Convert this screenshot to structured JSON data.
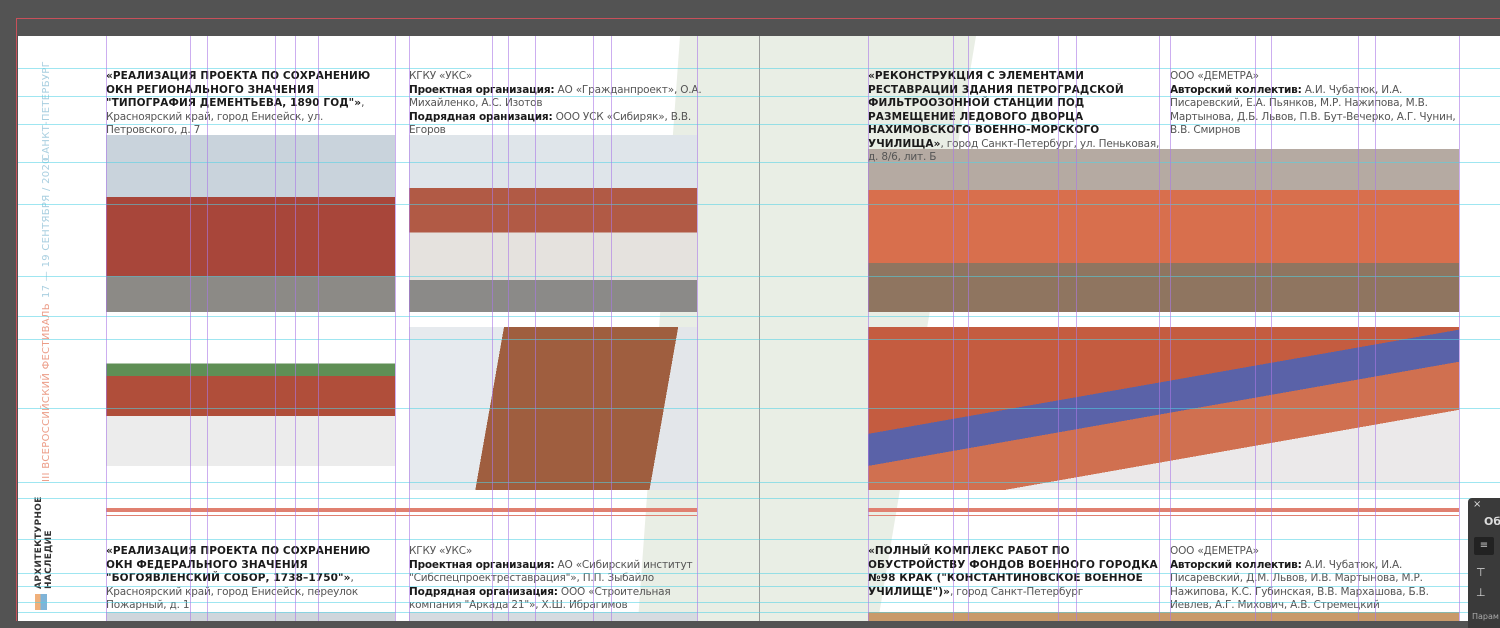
{
  "sidebar": {
    "city": "САНКТ-ПЕТЕРБУРГ",
    "dates": "17 — 19 СЕНТЯБРЯ / 2020",
    "festival": "III ВСЕРОССИЙСКИЙ ФЕСТИВАЛЬ",
    "logo_line1": "АРХИТЕКТУРНОЕ",
    "logo_line2": "НАСЛЕДИЕ"
  },
  "projects": [
    {
      "title": "«РЕАЛИЗАЦИЯ ПРОЕКТА ПО СОХРАНЕНИЮ ОКН РЕГИОНАЛЬНОГО ЗНАЧЕНИЯ \"ТИПОГРАФИЯ ДЕМЕНТЬЕВА, 1890 ГОД\"»",
      "address": ", Красноярский край, город Енисейск, ул. Петровского, д. 7",
      "client": "КГКУ «УКС»",
      "design_label": "Проектная организация:",
      "design": " АО «Гражданпроект», О.А. Михайленко, А.С. Изотов",
      "contractor_label": "Подрядная оранизация:",
      "contractor": " ООО УСК «Сибиряк», В.В. Егоров"
    },
    {
      "title": "«РЕКОНСТРУКЦИЯ С ЭЛЕМЕНТАМИ РЕСТАВРАЦИИ ЗДАНИЯ ПЕТРОГРАДСКОЙ ФИЛЬТРООЗОННОЙ СТАНЦИИ ПОД РАЗМЕЩЕНИЕ ЛЕДОВОГО ДВОРЦА НАХИМОВСКОГО ВОЕННО-МОРСКОГО УЧИЛИЩА»",
      "address": ", город Санкт-Петербург, ул. Пеньковая, д. 8/6, лит. Б",
      "client": "ООО «ДЕМЕТРА»",
      "authors_label": "Авторский коллектив:",
      "authors": " А.И. Чубатюк, И.А. Писаревский, Е.А. Пьянков, М.Р. Нажипова, М.В. Мартынова, Д.Б. Львов, П.В. Бут-Вечерко, А.Г. Чунин, В.В. Смирнов"
    },
    {
      "title": "«РЕАЛИЗАЦИЯ ПРОЕКТА ПО СОХРАНЕНИЮ ОКН ФЕДЕРАЛЬНОГО ЗНАЧЕНИЯ \"БОГОЯВЛЕНСКИЙ СОБОР, 1738–1750\"»",
      "address": ", Красноярский край, город Енисейск, переулок Пожарный, д. 1",
      "client": "КГКУ «УКС»",
      "design_label": "Проектная организация:",
      "design": " АО «Сибирский институт \"Сибспецпроектреставрация\"», П.П. Зыбайло",
      "contractor_label": "Подрядная организация:",
      "contractor": " ООО «Строительная компания \"Аркада 21\"», Х.Ш. Ибрагимов"
    },
    {
      "title": "«ПОЛНЫЙ КОМПЛЕКС РАБОТ ПО ОБУСТРОЙСТВУ ФОНДОВ ВОЕННОГО ГОРОДКА №98 КРАК (\"КОНСТАНТИНОВСКОЕ ВОЕННОЕ УЧИЛИЩЕ\")»",
      "address": ", город Санкт-Петербург",
      "client": "ООО «ДЕМЕТРА»",
      "authors_label": "Авторский коллектив:",
      "authors": " А.И. Чубатюк, И.А. Писаревский, Д.М. Львов, И.В. Мартынова, М.Р. Нажипова, К.С. Губинская, В.В. Мархашова, Б.В. Иевлев, А.Г. Михович, А.В. Стремецкий"
    }
  ],
  "panel": {
    "title": "Об",
    "close": "×",
    "footer": "Парам"
  },
  "colors": {
    "brick": "#b4553e",
    "accent_red": "#e08070",
    "guide": "#50d2e6",
    "diag": "#e8ede4"
  }
}
